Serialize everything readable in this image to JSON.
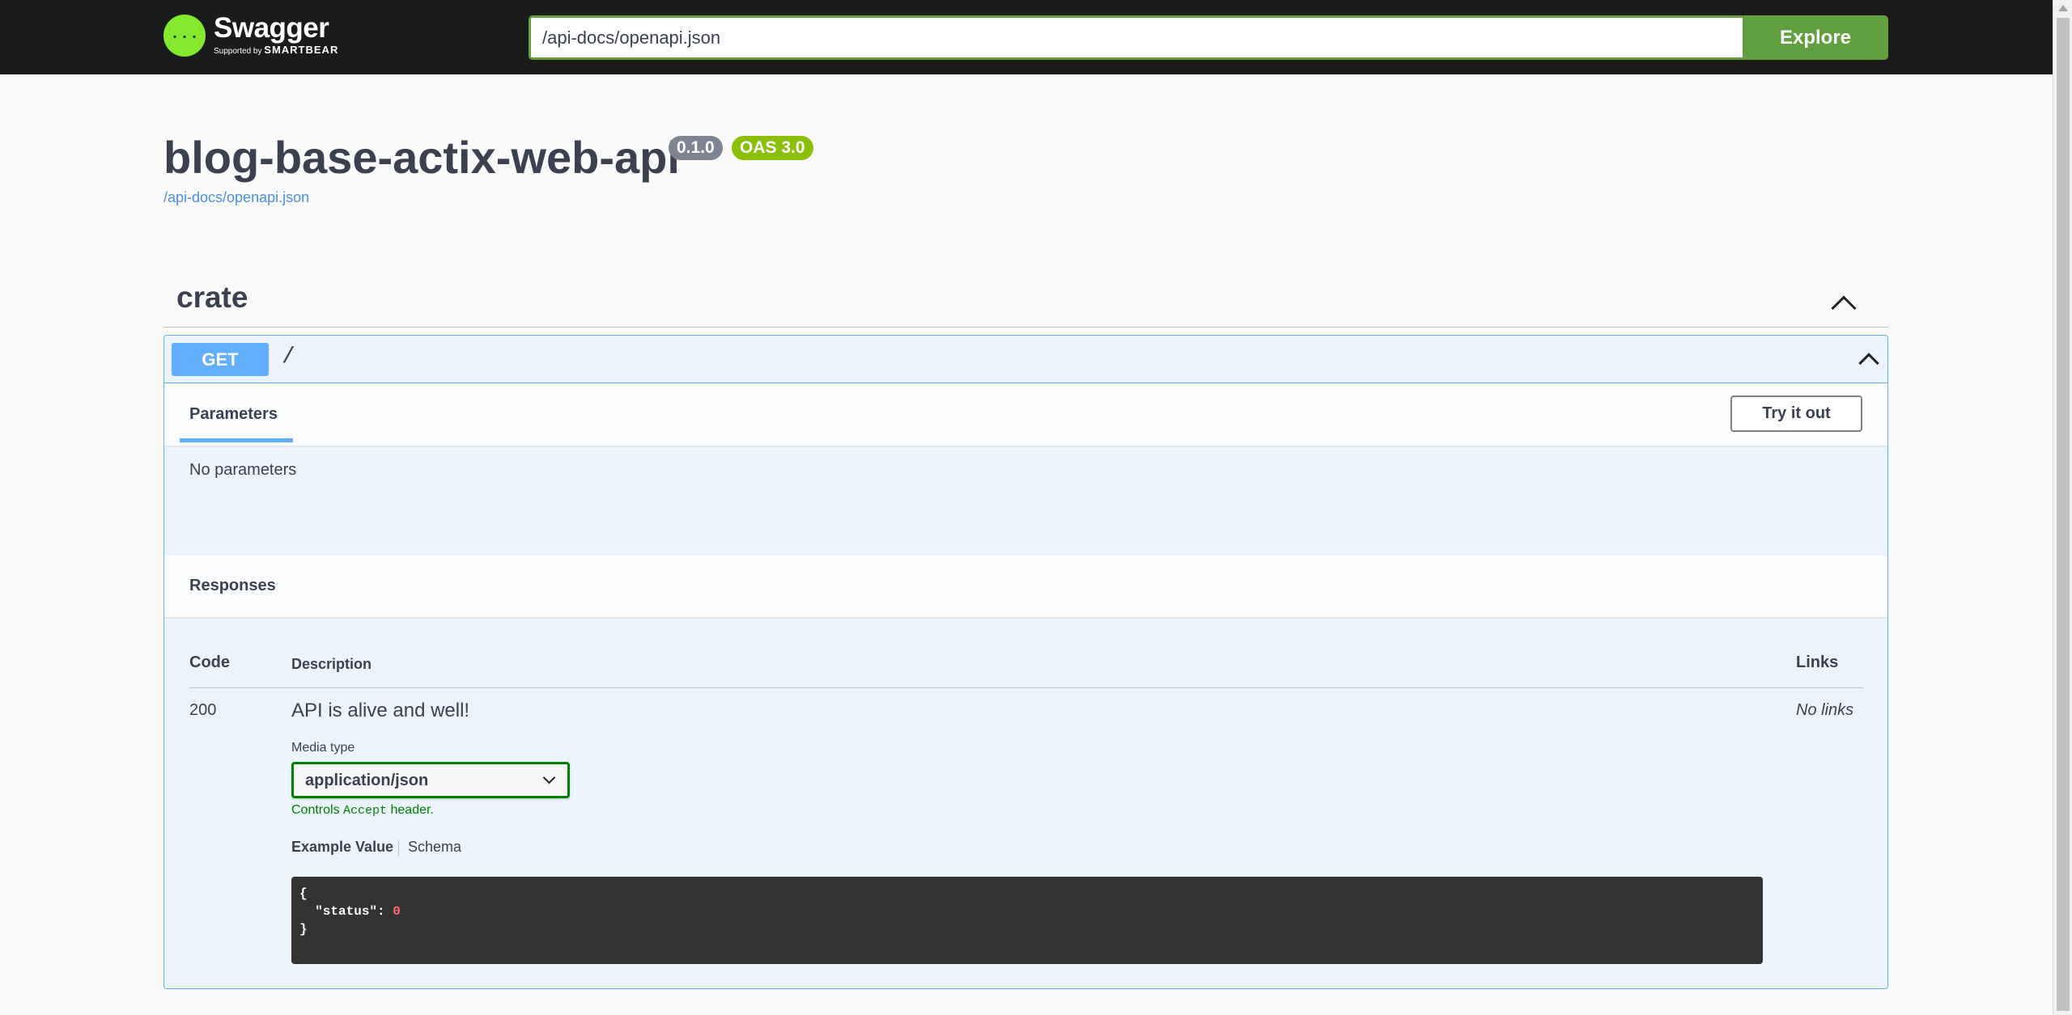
{
  "topbar": {
    "logo_title": "Swagger",
    "logo_sub_prefix": "Supported by",
    "logo_sub_brand": "SMARTBEAR",
    "url_value": "/api-docs/openapi.json",
    "explore_label": "Explore"
  },
  "info": {
    "title": "blog-base-actix-web-api",
    "version": "0.1.0",
    "oas": "OAS 3.0",
    "spec_url": "/api-docs/openapi.json"
  },
  "tag": {
    "name": "crate"
  },
  "operation": {
    "method": "GET",
    "path": "/",
    "parameters_tab": "Parameters",
    "try_it_out_label": "Try it out",
    "no_parameters": "No parameters",
    "responses_title": "Responses",
    "columns": {
      "code": "Code",
      "description": "Description",
      "links": "Links"
    },
    "response": {
      "code": "200",
      "description": "API is alive and well!",
      "links": "No links",
      "media_type_label": "Media type",
      "media_type_value": "application/json",
      "controls_prefix": "Controls ",
      "controls_code": "Accept",
      "controls_suffix": " header.",
      "example_tab": "Example Value",
      "schema_tab": "Schema",
      "example_line1": "{",
      "example_key": "  \"status\": ",
      "example_value": "0",
      "example_line3": "}"
    }
  },
  "colors": {
    "topbar_bg": "#1b1b1b",
    "accent_green": "#62a03f",
    "get_blue": "#61affe",
    "oas_green": "#89bf04",
    "version_gray": "#7d8492"
  },
  "icons": {
    "logo": "swagger-logo-icon",
    "tag_toggle": "chevron-up-icon",
    "op_toggle": "chevron-up-icon",
    "select": "chevron-down-icon"
  }
}
